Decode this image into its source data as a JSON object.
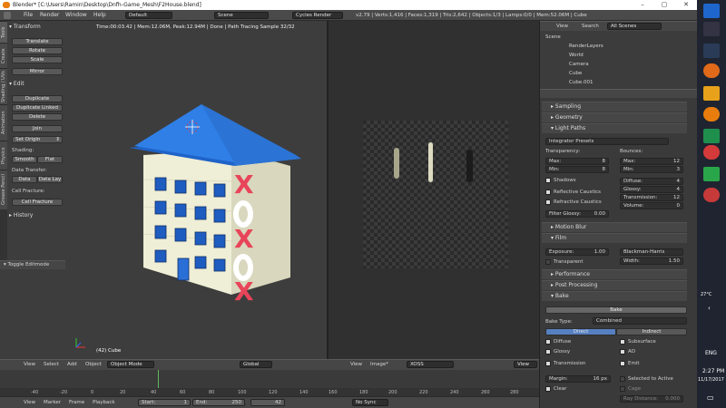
{
  "window": {
    "title": "Blender* [C:\\Users\\Ramin\\Desktop\\Dnfh-Game_Mesh\\F2House.blend]",
    "buttons": [
      "–",
      "▢",
      "✕"
    ]
  },
  "infobar": {
    "menus": [
      "File",
      "Render",
      "Window",
      "Help"
    ],
    "layout": "Default",
    "scene": "Scene",
    "engine": "Cycles Render",
    "stats": "v2.79 | Verts:1,416 | Faces:1,319 | Tris:2,642 | Objects:1/3 | Lamps:0/0 | Mem:52.06M | Cube"
  },
  "toolshelf": {
    "tabs": [
      "Tools",
      "Create",
      "Shading / UVs",
      "Animation",
      "Physics",
      "Grease Pencil"
    ],
    "transform_header": "Transform",
    "transform_buttons": [
      "Translate",
      "Rotate",
      "Scale"
    ],
    "mirror": "Mirror",
    "edit_header": "Edit",
    "edit_buttons": [
      "Duplicate",
      "Duplicate Linked",
      "Delete"
    ],
    "join": "Join",
    "set_origin": "Set Origin",
    "shading_label": "Shading:",
    "smooth": "Smooth",
    "flat": "Flat",
    "data_transfer_label": "Data Transfer:",
    "data": "Data",
    "data_lay": "Data Lay",
    "cell_fracture_label": "Cell Fracture:",
    "cell_fracture": "Cell Fracture",
    "history": "History",
    "toggle_editmode": "Toggle Editmode"
  },
  "viewport": {
    "status": "Time:00:03.42 | Mem:12.06M, Peak:12.94M | Done | Path Tracing Sample 32/32",
    "object_label": "(42) Cube",
    "menus": [
      "View",
      "Select",
      "Add",
      "Object"
    ],
    "mode": "Object Mode",
    "orientation": "Global"
  },
  "image_editor": {
    "menus": [
      "View",
      "Image*"
    ],
    "image_name": "XOSS",
    "view_label": "View"
  },
  "outliner": {
    "menus": [
      "View",
      "Search"
    ],
    "filter": "All Scenes",
    "items": [
      "Scene",
      "RenderLayers",
      "World",
      "Camera",
      "Cube",
      "Cube.001"
    ]
  },
  "properties": {
    "sampling": "Sampling",
    "geometry": "Geometry",
    "light_paths": "Light Paths",
    "integrator_presets": "Integrator Presets",
    "transparency_label": "Transparency:",
    "bounces_label": "Bounces:",
    "transp_max_label": "Max:",
    "transp_max": "8",
    "transp_min_label": "Min:",
    "transp_min": "8",
    "b_max_label": "Max:",
    "b_max": "12",
    "b_min_label": "Min:",
    "b_min": "3",
    "diffuse_label": "Diffuse:",
    "diffuse": "4",
    "glossy_label": "Glossy:",
    "glossy": "4",
    "transmission_label": "Transmission:",
    "transmission": "12",
    "volume_label": "Volume:",
    "volume": "0",
    "shadows": "Shadows",
    "reflective_caustics": "Reflective Caustics",
    "refractive_caustics": "Refractive Caustics",
    "filter_glossy_label": "Filter Glossy:",
    "filter_glossy": "0.00",
    "motion_blur": "Motion Blur",
    "film": "Film",
    "exposure_label": "Exposure:",
    "exposure": "1.00",
    "filter_type": "Blackman-Harris",
    "transparent": "Transparent",
    "width_label": "Width:",
    "width": "1.50",
    "performance": "Performance",
    "post_processing": "Post Processing",
    "bake": "Bake",
    "bake_button": "Bake",
    "bake_type_label": "Bake Type:",
    "bake_type": "Combined",
    "direct": "Direct",
    "indirect": "Indirect",
    "diffuse_chk": "Diffuse",
    "glossy_chk": "Glossy",
    "transmission_chk": "Transmission",
    "subsurface_chk": "Subsurface",
    "ao_chk": "AO",
    "emit_chk": "Emit",
    "margin_label": "Margin:",
    "margin": "16 px",
    "clear": "Clear",
    "selected_to_active": "Selected to Active",
    "cage": "Cage",
    "ray_distance_label": "Ray Distance:",
    "ray_distance": "0.000"
  },
  "timeline": {
    "ticks": [
      "-40",
      "-20",
      "0",
      "20",
      "40",
      "60",
      "80",
      "100",
      "120",
      "140",
      "160",
      "180",
      "200",
      "220",
      "240",
      "260",
      "280"
    ],
    "menus": [
      "View",
      "Marker",
      "Frame",
      "Playback"
    ],
    "start_label": "Start:",
    "start": "1",
    "end_label": "End:",
    "end": "250",
    "current": "42",
    "sync": "No Sync"
  },
  "taskbar": {
    "lang": "ENG",
    "time": "2:27 PM",
    "date": "11/17/2017",
    "temp": "27°C"
  },
  "colors": {
    "roof": "#2f7fe6",
    "walls": "#efeed6",
    "windows": "#1e5cc0",
    "x_marks": "#e8445a",
    "o_marks": "#ffffff"
  }
}
